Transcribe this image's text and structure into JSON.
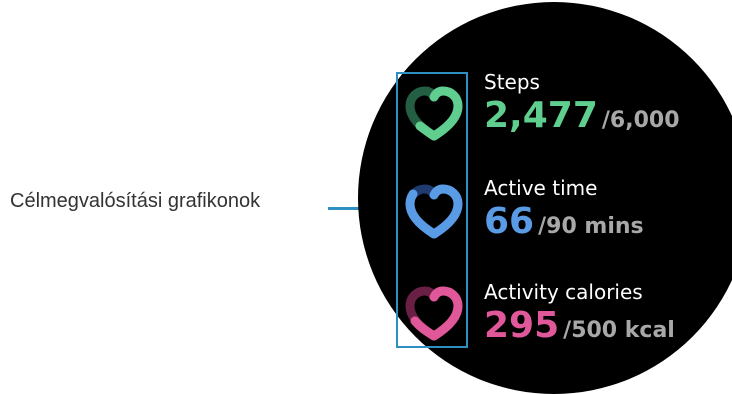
{
  "callout": {
    "label": "Célmegvalósítási grafikonok"
  },
  "metrics": [
    {
      "label": "Steps",
      "current": "2,477",
      "goal": "/6,000",
      "progress": 0.41,
      "color": "#5fce8f",
      "icon": "heart-progress-icon"
    },
    {
      "label": "Active time",
      "current": "66",
      "goal": "/90 mins",
      "progress": 0.73,
      "color": "#5a9be6",
      "icon": "heart-progress-icon"
    },
    {
      "label": "Activity calories",
      "current": "295",
      "goal": "/500 kcal",
      "progress": 0.59,
      "color": "#e0589a",
      "icon": "heart-progress-icon"
    }
  ],
  "colors": {
    "callout": "#2f8ec2",
    "goal_text": "#a8a8a8",
    "watch_face": "#000000"
  }
}
